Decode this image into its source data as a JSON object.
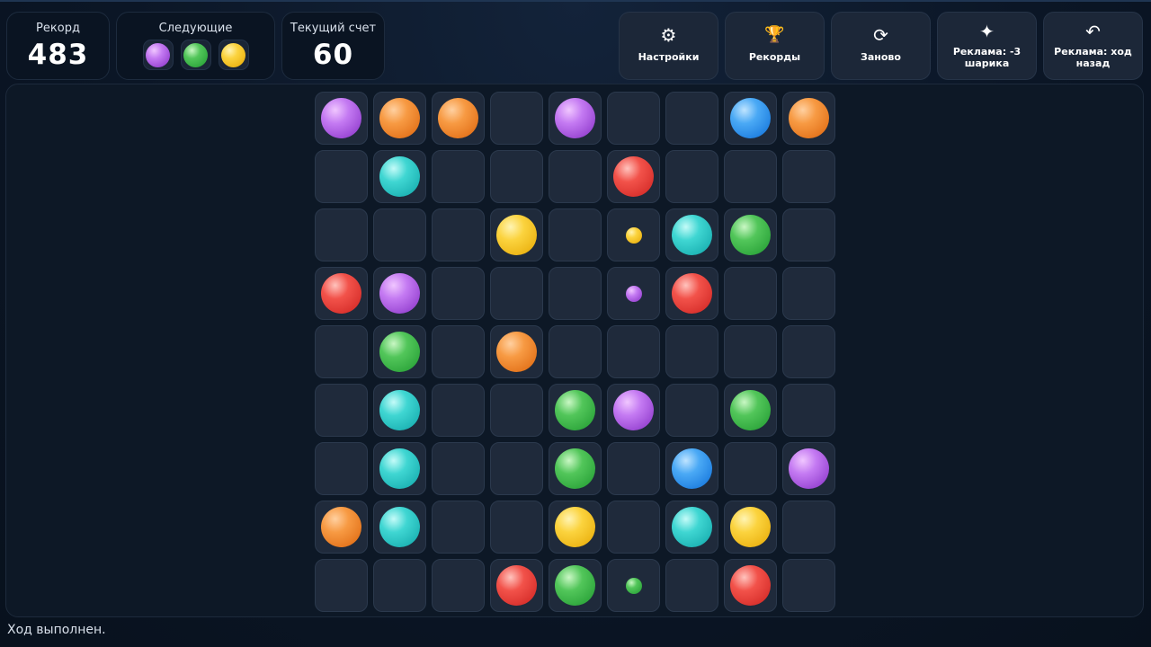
{
  "header": {
    "record_label": "Рекорд",
    "record_value": "483",
    "next_label": "Следующие",
    "next_balls": [
      "purple",
      "green",
      "yellow"
    ],
    "score_label": "Текущий счет",
    "score_value": "60"
  },
  "toolbar": [
    {
      "id": "settings",
      "icon": "⚙",
      "icon_name": "gear-icon",
      "label": "Настройки"
    },
    {
      "id": "records",
      "icon": "🏆",
      "icon_name": "trophy-icon",
      "label": "Рекорды"
    },
    {
      "id": "restart",
      "icon": "⟳",
      "icon_name": "restart-icon",
      "label": "Заново"
    },
    {
      "id": "ad-remove-balls",
      "icon": "✦",
      "icon_name": "sparkle-icon",
      "label": "Реклама: -3 шарика"
    },
    {
      "id": "ad-undo",
      "icon": "↶",
      "icon_name": "undo-icon",
      "label": "Реклама: ход назад"
    }
  ],
  "board": {
    "rows": 9,
    "cols": 9,
    "cells": [
      [
        "purple",
        "orange",
        "orange",
        "",
        "purple",
        "",
        "",
        "blue",
        "orange"
      ],
      [
        "",
        "cyan",
        "",
        "",
        "",
        "red",
        "",
        "",
        ""
      ],
      [
        "",
        "",
        "",
        "yellow",
        "",
        "yellow.s",
        "cyan",
        "green",
        ""
      ],
      [
        "red",
        "purple",
        "",
        "",
        "",
        "purple.s",
        "red",
        "",
        ""
      ],
      [
        "",
        "green",
        "",
        "orange",
        "",
        "",
        "",
        "",
        ""
      ],
      [
        "",
        "cyan",
        "",
        "",
        "green",
        "purple",
        "",
        "green",
        ""
      ],
      [
        "",
        "cyan",
        "",
        "",
        "green",
        "",
        "blue",
        "",
        "purple"
      ],
      [
        "orange",
        "cyan",
        "",
        "",
        "yellow",
        "",
        "cyan",
        "yellow",
        ""
      ],
      [
        "",
        "",
        "",
        "red",
        "green",
        "green.s",
        "",
        "red",
        ""
      ]
    ]
  },
  "status": "Ход выполнен."
}
